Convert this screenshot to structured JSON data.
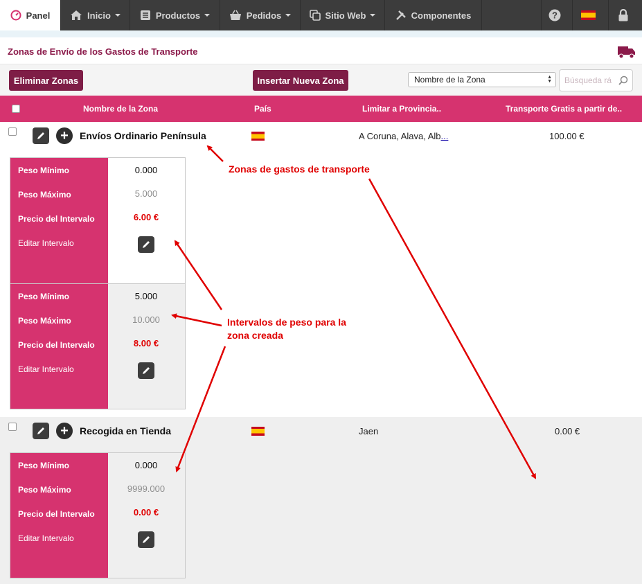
{
  "nav": {
    "panel": "Panel",
    "inicio": "Inicio",
    "productos": "Productos",
    "pedidos": "Pedidos",
    "sitio_web": "Sitio Web",
    "componentes": "Componentes"
  },
  "page": {
    "title": "Zonas de Envío de los Gastos de Transporte"
  },
  "toolbar": {
    "delete_label": "Eliminar Zonas",
    "insert_label": "Insertar Nueva Zona",
    "sort_selected": "Nombre de la Zona",
    "search_placeholder": "Búsqueda rá"
  },
  "table": {
    "headers": [
      "Nombre de la Zona",
      "País",
      "Limitar a Provincia..",
      "Transporte Gratis a partir de.."
    ],
    "zones": [
      {
        "name": "Envíos Ordinario Península",
        "provinces": "A Coruna, Alava, Alb",
        "more_link": "...",
        "free_from": "100.00 €",
        "intervals": [
          {
            "min": "0.000",
            "max": "5.000",
            "price": "6.00 €"
          },
          {
            "min": "5.000",
            "max": "10.000",
            "price": "8.00 €"
          }
        ]
      },
      {
        "name": "Recogida en Tienda",
        "provinces": "Jaen",
        "free_from": "0.00 €",
        "intervals": [
          {
            "min": "0.000",
            "max": "9999.000",
            "price": "0.00 €"
          }
        ]
      }
    ]
  },
  "interval_labels": {
    "min": "Peso Mínimo",
    "max": "Peso Máximo",
    "price": "Precio del Intervalo",
    "edit": "Editar Intervalo"
  },
  "annotations": {
    "zones": "Zonas de gastos de transporte",
    "intervals_line1": "Intervalos de peso para la",
    "intervals_line2": "zona creada"
  },
  "colors": {
    "nav_bg": "#3c3c3c",
    "accent_pink": "#d6336f",
    "button_maroon": "#7e1d46",
    "annotation_red": "#e00000"
  },
  "icons": [
    "dashboard-icon",
    "home-icon",
    "products-icon",
    "basket-icon",
    "pages-icon",
    "tools-icon",
    "help-icon",
    "spain-flag-icon",
    "lock-icon",
    "truck-icon",
    "search-icon",
    "pencil-icon",
    "plus-icon"
  ]
}
